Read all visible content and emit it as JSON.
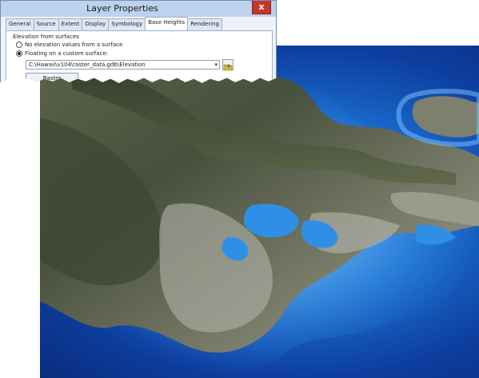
{
  "dialog": {
    "title": "Layer Properties",
    "close_label": "x",
    "tabs": [
      {
        "label": "General"
      },
      {
        "label": "Source"
      },
      {
        "label": "Extent"
      },
      {
        "label": "Display"
      },
      {
        "label": "Symbology"
      },
      {
        "label": "Base Heights",
        "active": true
      },
      {
        "label": "Rendering"
      }
    ],
    "elevation": {
      "group_label": "Elevation from surfaces",
      "options": [
        {
          "label": "No elevation values from a surface",
          "checked": false
        },
        {
          "label": "Floating on a custom surface:",
          "checked": true
        }
      ],
      "surface_path": "C:\\Hawaii\\v104\\raster_data.gdb\\Elevation",
      "raster_button": "Raster Resolution..."
    }
  },
  "scene": {
    "description_icon": "terrain-3d-view",
    "colors": {
      "deep_ocean": "#0a2c7e",
      "shallow_ocean": "#3f9ae8",
      "land_dark": "#3f4a3a",
      "land_light": "#8a8f7a"
    }
  }
}
